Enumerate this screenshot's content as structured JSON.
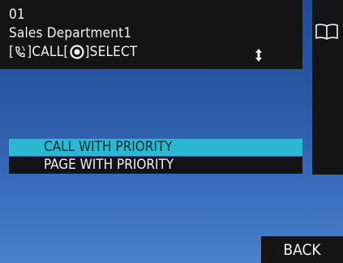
{
  "header": {
    "number": "01",
    "name": "Sales Department1",
    "hint": {
      "open_bracket_1": "[",
      "close_bracket_1": "]",
      "call_label": "CALL",
      "open_bracket_2": "[",
      "close_bracket_2": "]",
      "select_label": "SELECT"
    },
    "icons": {
      "handset": "handset-icon",
      "select": "select-knob-icon",
      "scroll": "scroll-up-down-icon",
      "book": "phonebook-icon"
    }
  },
  "menu": {
    "items": [
      {
        "label": "CALL WITH PRIORITY",
        "selected": true
      },
      {
        "label": "PAGE WITH PRIORITY",
        "selected": false
      }
    ]
  },
  "footer": {
    "back_label": "BACK"
  },
  "colors": {
    "panel": "#141414",
    "highlight": "#2ab9d0",
    "background_top": "#1f4c94",
    "background_bottom": "#4a80cc",
    "text": "#f2f2f2"
  }
}
